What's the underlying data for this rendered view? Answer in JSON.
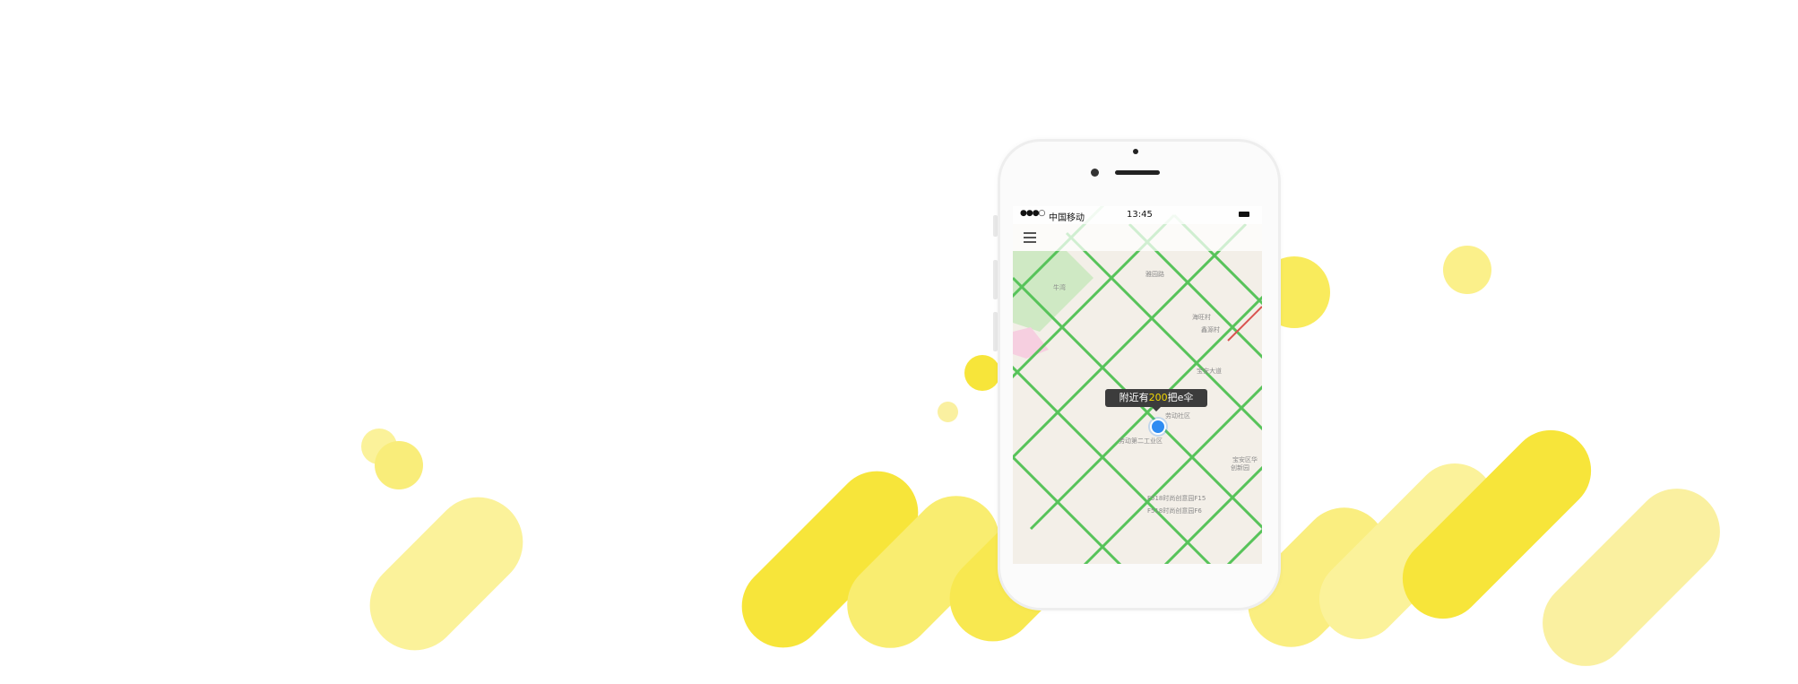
{
  "status_bar": {
    "signal": "●●●○",
    "carrier": "中国移动",
    "time": "13:45",
    "battery_icon": "battery-icon"
  },
  "nav": {
    "menu_icon": "menu-icon"
  },
  "map": {
    "labels": [
      "牛湾",
      "宝安区华",
      "创新园",
      "F518时尚创意园F15",
      "F518时尚创意园F6",
      "劳动第二工业区",
      "劳动社区",
      "宝安大道",
      "海旺村",
      "雅园路",
      "鑫源村"
    ],
    "tip": {
      "prefix": "附近有",
      "count": "200",
      "suffix": "把e伞"
    }
  },
  "colors": {
    "accent_yellow": "#f7e53a",
    "road_green": "#57c35a",
    "tip_bg": "#3c3c3c",
    "location_blue": "#2f8cf2"
  }
}
